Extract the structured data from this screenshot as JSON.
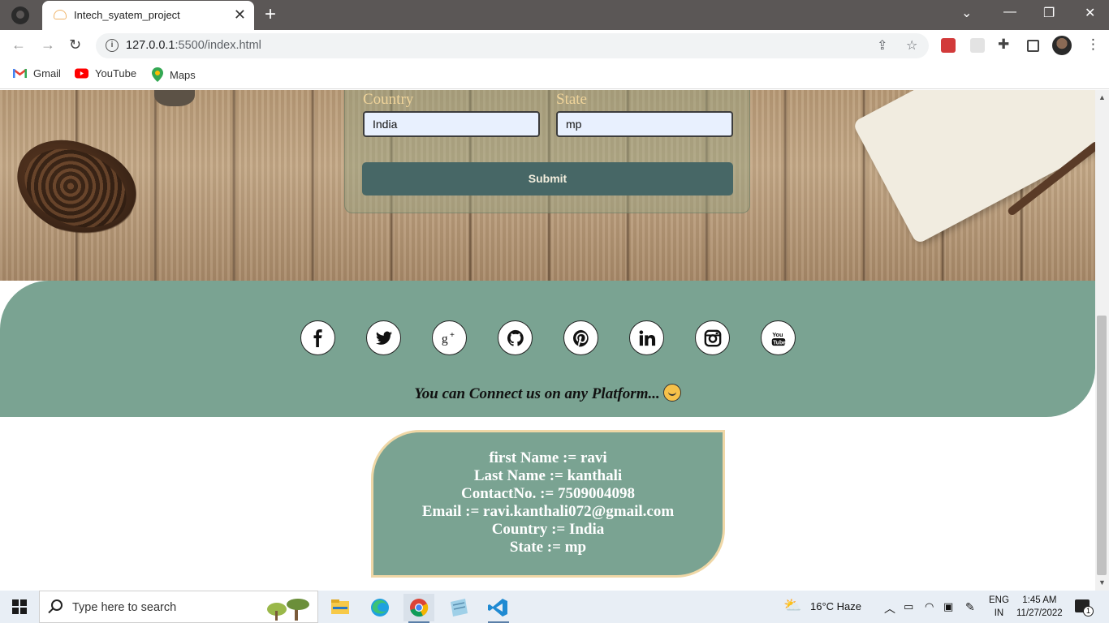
{
  "browser": {
    "tab_title": "Intech_syatem_project",
    "url_host": "127.0.0.1",
    "url_rest": ":5500/index.html",
    "bookmarks": [
      "Gmail",
      "YouTube",
      "Maps"
    ]
  },
  "form": {
    "country_label": "Country",
    "state_label": "State",
    "country_value": "India",
    "state_value": "mp",
    "submit_label": "Submit"
  },
  "social": {
    "icons": [
      "facebook-icon",
      "twitter-icon",
      "google-plus-icon",
      "github-icon",
      "pinterest-icon",
      "linkedin-icon",
      "instagram-icon",
      "youtube-icon"
    ],
    "connect_text": "You can Connect us on any Platform..."
  },
  "info_card": {
    "lines": [
      "first Name := ravi",
      "Last Name := kanthali",
      "ContactNo. := 7509004098",
      "Email := ravi.kanthali072@gmail.com",
      "Country := India",
      "State := mp"
    ]
  },
  "taskbar": {
    "search_placeholder": "Type here to search",
    "weather": "16°C  Haze",
    "lang_top": "ENG",
    "lang_bottom": "IN",
    "time": "1:45 AM",
    "date": "11/27/2022",
    "notification_count": "1"
  },
  "colors": {
    "accent_green": "#7aa392",
    "button_teal": "#476766",
    "label_gold": "#f0d49a"
  }
}
